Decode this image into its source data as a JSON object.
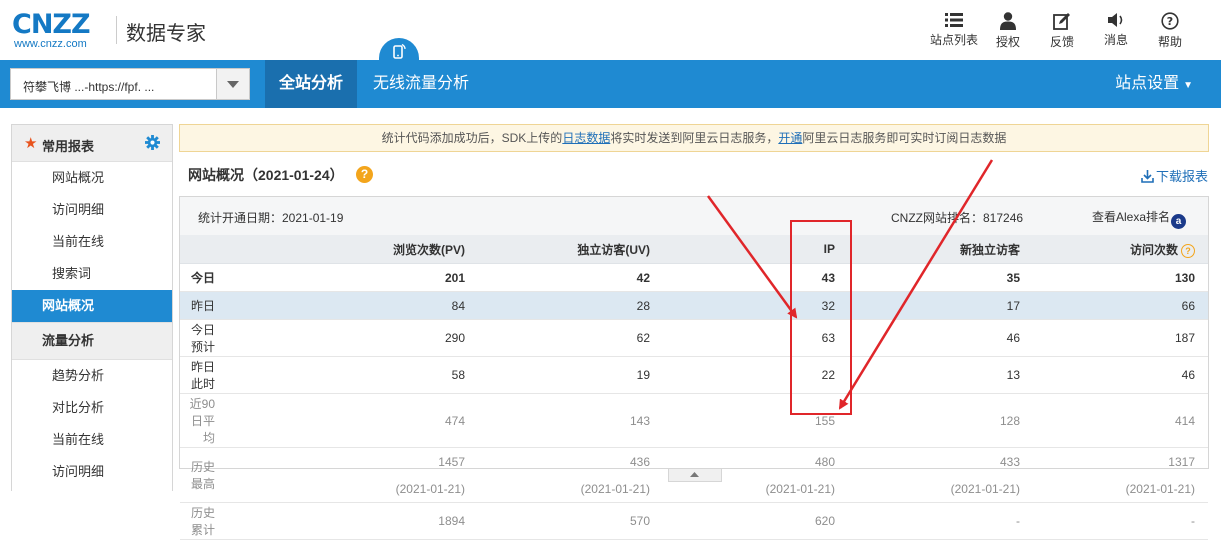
{
  "brand": {
    "logo": "CNZZ",
    "logo_sub": "www.cnzz.com",
    "product": "数据专家"
  },
  "topnav": [
    {
      "label": "站点列表",
      "icon": "list-icon"
    },
    {
      "label": "授权",
      "icon": "user-icon"
    },
    {
      "label": "反馈",
      "icon": "edit-icon"
    },
    {
      "label": "消息",
      "icon": "speaker-icon"
    },
    {
      "label": "帮助",
      "icon": "help-icon"
    }
  ],
  "site_select": {
    "value": "符攀飞博 ...-https://fpf. ..."
  },
  "tabs": {
    "full": "全站分析",
    "mobile": "无线流量分析"
  },
  "site_settings": "站点设置",
  "sidebar": {
    "common_title": "常用报表",
    "common_items": [
      "网站概况",
      "访问明细",
      "当前在线",
      "搜索词"
    ],
    "active_item": "网站概况",
    "traffic_title": "流量分析",
    "traffic_items": [
      "趋势分析",
      "对比分析",
      "当前在线",
      "访问明细"
    ]
  },
  "notice": {
    "part1": "统计代码添加成功后，SDK上传的",
    "link1": "日志数据",
    "part2": "将实时发送到阿里云日志服务，",
    "link2": "开通",
    "part3": "阿里云日志服务即可实时订阅日志数据"
  },
  "overview": {
    "title": "网站概况（2021-01-24）",
    "help": "?",
    "download": "下载报表",
    "open_date": "统计开通日期：2021-01-19",
    "rank": "CNZZ网站排名：817246",
    "alexa": "查看Alexa排名"
  },
  "table": {
    "headers": [
      "浏览次数(PV)",
      "独立访客(UV)",
      "IP",
      "新独立访客",
      "访问次数"
    ],
    "rows": [
      {
        "label": "今日",
        "values": [
          "201",
          "42",
          "43",
          "35",
          "130"
        ]
      },
      {
        "label": "昨日",
        "values": [
          "84",
          "28",
          "32",
          "17",
          "66"
        ]
      },
      {
        "label": "今日预计",
        "values": [
          "290",
          "62",
          "63",
          "46",
          "187"
        ]
      },
      {
        "label": "昨日此时",
        "values": [
          "58",
          "19",
          "22",
          "13",
          "46"
        ]
      },
      {
        "label": "近90日平均",
        "values": [
          "474",
          "143",
          "155",
          "128",
          "414"
        ]
      },
      {
        "label": "历史最高",
        "values": [
          "1457",
          "436",
          "480",
          "433",
          "1317"
        ]
      },
      {
        "label": "",
        "values": [
          "(2021-01-21)",
          "(2021-01-21)",
          "(2021-01-21)",
          "(2021-01-21)",
          "(2021-01-21)"
        ]
      },
      {
        "label": "历史累计",
        "values": [
          "1894",
          "570",
          "620",
          "-",
          "-"
        ]
      }
    ]
  },
  "colors": {
    "brand_blue": "#1f8ad2",
    "active_tab": "#1a6fae",
    "annotation_red": "#e0262a",
    "highlight_row": "#dce8f2"
  }
}
